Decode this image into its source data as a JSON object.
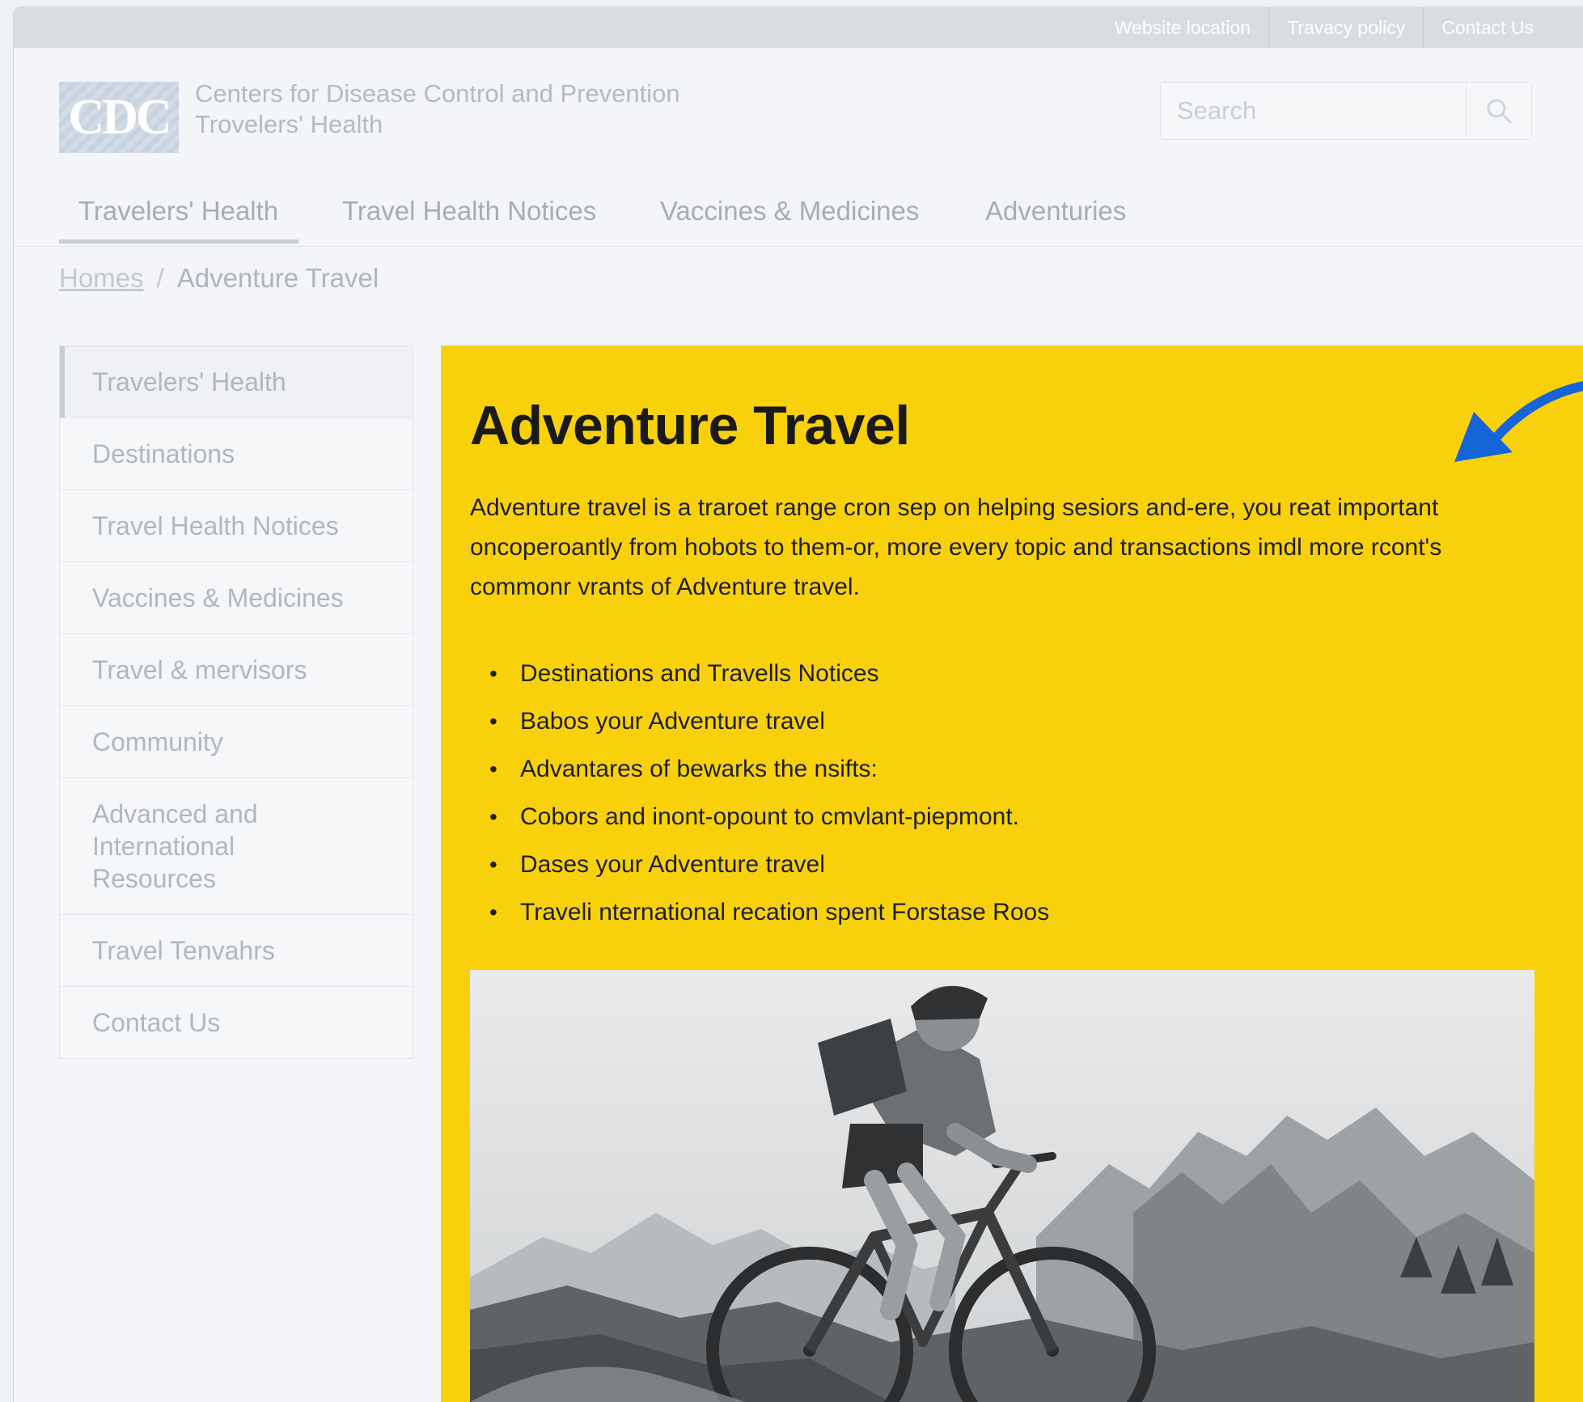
{
  "top_links": [
    "Website location",
    "Travacy policy",
    "Contact Us"
  ],
  "header": {
    "logo_text": "CDC",
    "agency_line1": "Centers for Disease Control and Prevention",
    "agency_line2": "Trovelers' Health"
  },
  "search": {
    "placeholder": "Search",
    "icon": "search-icon"
  },
  "nav": {
    "tabs": [
      "Travelers' Health",
      "Travel Health Notices",
      "Vaccines & Medicines",
      "Adventuries"
    ],
    "active": "Travelers' Health"
  },
  "breadcrumb": {
    "home": "Homes",
    "current": "Adventure Travel"
  },
  "sidebar": {
    "items": [
      "Travelers' Health",
      "Destinations",
      "Travel Health Notices",
      "Vaccines & Medicines",
      "Travel & mervisors",
      "Community",
      "Advanced and International Resources",
      "Travel Tenvahrs",
      "Contact Us"
    ],
    "active": "Travelers' Health"
  },
  "main": {
    "title": "Adventure Travel",
    "intro": "Adventure travel is a traroet range cron sep on helping sesiors and-ere, you reat important oncoperoantly from hobots to them-or, more every topic and transactions imdl more rcont's commonr vrants of Adventure travel.",
    "bullets": [
      "Destinations and Travells Notices",
      "Babos your Adventure travel",
      "Advantares of bewarks the nsifts:",
      "Cobors and inont-opount to cmvlant-piepmont.",
      "Dases your Adventure travel",
      "Traveli nternational recation spent Forstase Roos"
    ],
    "photo_subject": "mountain-biker-photo"
  },
  "colors": {
    "highlight": "#f9d10a",
    "arrow": "#1565d8",
    "page_bg": "#f3f5f8"
  }
}
